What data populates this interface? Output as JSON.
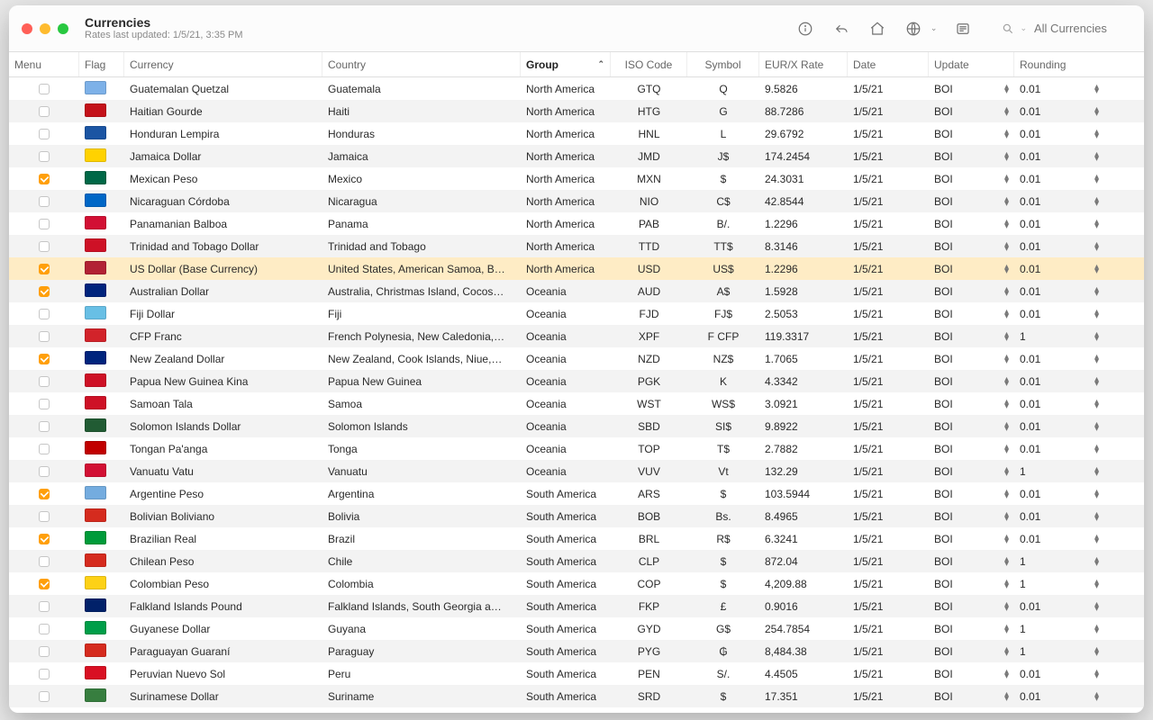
{
  "header": {
    "title": "Currencies",
    "subtitle": "Rates last updated: 1/5/21, 3:35 PM",
    "search_placeholder": "All Currencies"
  },
  "columns": {
    "menu": "Menu",
    "flag": "Flag",
    "currency": "Currency",
    "country": "Country",
    "group": "Group",
    "iso": "ISO Code",
    "symbol": "Symbol",
    "rate": "EUR/X Rate",
    "date": "Date",
    "update": "Update",
    "rounding": "Rounding"
  },
  "sort_column": "group",
  "rows": [
    {
      "checked": false,
      "flag": "#7db1e8",
      "currency": "Guatemalan Quetzal",
      "country": "Guatemala",
      "group": "North America",
      "iso": "GTQ",
      "symbol": "Q",
      "rate": "9.5826",
      "date": "1/5/21",
      "update": "BOI",
      "rounding": "0.01"
    },
    {
      "checked": false,
      "flag": "#c4121a",
      "currency": "Haitian Gourde",
      "country": "Haiti",
      "group": "North America",
      "iso": "HTG",
      "symbol": "G",
      "rate": "88.7286",
      "date": "1/5/21",
      "update": "BOI",
      "rounding": "0.01"
    },
    {
      "checked": false,
      "flag": "#1b55a3",
      "currency": "Honduran Lempira",
      "country": "Honduras",
      "group": "North America",
      "iso": "HNL",
      "symbol": "L",
      "rate": "29.6792",
      "date": "1/5/21",
      "update": "BOI",
      "rounding": "0.01"
    },
    {
      "checked": false,
      "flag": "#ffd200",
      "currency": "Jamaica Dollar",
      "country": "Jamaica",
      "group": "North America",
      "iso": "JMD",
      "symbol": "J$",
      "rate": "174.2454",
      "date": "1/5/21",
      "update": "BOI",
      "rounding": "0.01"
    },
    {
      "checked": true,
      "flag": "#006847",
      "currency": "Mexican Peso",
      "country": "Mexico",
      "group": "North America",
      "iso": "MXN",
      "symbol": "$",
      "rate": "24.3031",
      "date": "1/5/21",
      "update": "BOI",
      "rounding": "0.01"
    },
    {
      "checked": false,
      "flag": "#0067c6",
      "currency": "Nicaraguan Córdoba",
      "country": "Nicaragua",
      "group": "North America",
      "iso": "NIO",
      "symbol": "C$",
      "rate": "42.8544",
      "date": "1/5/21",
      "update": "BOI",
      "rounding": "0.01"
    },
    {
      "checked": false,
      "flag": "#d21034",
      "currency": "Panamanian Balboa",
      "country": "Panama",
      "group": "North America",
      "iso": "PAB",
      "symbol": "B/.",
      "rate": "1.2296",
      "date": "1/5/21",
      "update": "BOI",
      "rounding": "0.01"
    },
    {
      "checked": false,
      "flag": "#ce1126",
      "currency": "Trinidad and Tobago Dollar",
      "country": "Trinidad and Tobago",
      "group": "North America",
      "iso": "TTD",
      "symbol": "TT$",
      "rate": "8.3146",
      "date": "1/5/21",
      "update": "BOI",
      "rounding": "0.01"
    },
    {
      "checked": true,
      "flag": "#b22234",
      "selected": true,
      "currency": "US Dollar (Base Currency)",
      "country": "United States, American Samoa, B…",
      "group": "North America",
      "iso": "USD",
      "symbol": "US$",
      "rate": "1.2296",
      "date": "1/5/21",
      "update": "BOI",
      "rounding": "0.01"
    },
    {
      "checked": true,
      "flag": "#00247d",
      "currency": "Australian Dollar",
      "country": "Australia, Christmas Island, Cocos…",
      "group": "Oceania",
      "iso": "AUD",
      "symbol": "A$",
      "rate": "1.5928",
      "date": "1/5/21",
      "update": "BOI",
      "rounding": "0.01"
    },
    {
      "checked": false,
      "flag": "#68bfe5",
      "currency": "Fiji Dollar",
      "country": "Fiji",
      "group": "Oceania",
      "iso": "FJD",
      "symbol": "FJ$",
      "rate": "2.5053",
      "date": "1/5/21",
      "update": "BOI",
      "rounding": "0.01"
    },
    {
      "checked": false,
      "flag": "#d2232a",
      "currency": "CFP Franc",
      "country": "French Polynesia, New Caledonia,…",
      "group": "Oceania",
      "iso": "XPF",
      "symbol": "F CFP",
      "rate": "119.3317",
      "date": "1/5/21",
      "update": "BOI",
      "rounding": "1"
    },
    {
      "checked": true,
      "flag": "#00247d",
      "currency": "New Zealand Dollar",
      "country": "New Zealand, Cook Islands, Niue,…",
      "group": "Oceania",
      "iso": "NZD",
      "symbol": "NZ$",
      "rate": "1.7065",
      "date": "1/5/21",
      "update": "BOI",
      "rounding": "0.01"
    },
    {
      "checked": false,
      "flag": "#ce1126",
      "currency": "Papua New Guinea Kina",
      "country": "Papua New Guinea",
      "group": "Oceania",
      "iso": "PGK",
      "symbol": "K",
      "rate": "4.3342",
      "date": "1/5/21",
      "update": "BOI",
      "rounding": "0.01"
    },
    {
      "checked": false,
      "flag": "#ce1126",
      "currency": "Samoan Tala",
      "country": "Samoa",
      "group": "Oceania",
      "iso": "WST",
      "symbol": "WS$",
      "rate": "3.0921",
      "date": "1/5/21",
      "update": "BOI",
      "rounding": "0.01"
    },
    {
      "checked": false,
      "flag": "#215b33",
      "currency": "Solomon Islands Dollar",
      "country": "Solomon Islands",
      "group": "Oceania",
      "iso": "SBD",
      "symbol": "SI$",
      "rate": "9.8922",
      "date": "1/5/21",
      "update": "BOI",
      "rounding": "0.01"
    },
    {
      "checked": false,
      "flag": "#c10000",
      "currency": "Tongan Pa'anga",
      "country": "Tonga",
      "group": "Oceania",
      "iso": "TOP",
      "symbol": "T$",
      "rate": "2.7882",
      "date": "1/5/21",
      "update": "BOI",
      "rounding": "0.01"
    },
    {
      "checked": false,
      "flag": "#d21034",
      "currency": "Vanuatu Vatu",
      "country": "Vanuatu",
      "group": "Oceania",
      "iso": "VUV",
      "symbol": "Vt",
      "rate": "132.29",
      "date": "1/5/21",
      "update": "BOI",
      "rounding": "1"
    },
    {
      "checked": true,
      "flag": "#74acdf",
      "currency": "Argentine Peso",
      "country": "Argentina",
      "group": "South America",
      "iso": "ARS",
      "symbol": "$",
      "rate": "103.5944",
      "date": "1/5/21",
      "update": "BOI",
      "rounding": "0.01"
    },
    {
      "checked": false,
      "flag": "#d52b1e",
      "currency": "Bolivian Boliviano",
      "country": "Bolivia",
      "group": "South America",
      "iso": "BOB",
      "symbol": "Bs.",
      "rate": "8.4965",
      "date": "1/5/21",
      "update": "BOI",
      "rounding": "0.01"
    },
    {
      "checked": true,
      "flag": "#009b3a",
      "currency": "Brazilian Real",
      "country": "Brazil",
      "group": "South America",
      "iso": "BRL",
      "symbol": "R$",
      "rate": "6.3241",
      "date": "1/5/21",
      "update": "BOI",
      "rounding": "0.01"
    },
    {
      "checked": false,
      "flag": "#d52b1e",
      "currency": "Chilean Peso",
      "country": "Chile",
      "group": "South America",
      "iso": "CLP",
      "symbol": "$",
      "rate": "872.04",
      "date": "1/5/21",
      "update": "BOI",
      "rounding": "1"
    },
    {
      "checked": true,
      "flag": "#fdd116",
      "currency": "Colombian Peso",
      "country": "Colombia",
      "group": "South America",
      "iso": "COP",
      "symbol": "$",
      "rate": "4,209.88",
      "date": "1/5/21",
      "update": "BOI",
      "rounding": "1"
    },
    {
      "checked": false,
      "flag": "#012169",
      "currency": "Falkland Islands Pound",
      "country": "Falkland Islands, South Georgia a…",
      "group": "South America",
      "iso": "FKP",
      "symbol": "£",
      "rate": "0.9016",
      "date": "1/5/21",
      "update": "BOI",
      "rounding": "0.01"
    },
    {
      "checked": false,
      "flag": "#009e49",
      "currency": "Guyanese Dollar",
      "country": "Guyana",
      "group": "South America",
      "iso": "GYD",
      "symbol": "G$",
      "rate": "254.7854",
      "date": "1/5/21",
      "update": "BOI",
      "rounding": "1"
    },
    {
      "checked": false,
      "flag": "#d52b1e",
      "currency": "Paraguayan Guaraní",
      "country": "Paraguay",
      "group": "South America",
      "iso": "PYG",
      "symbol": "₲",
      "rate": "8,484.38",
      "date": "1/5/21",
      "update": "BOI",
      "rounding": "1"
    },
    {
      "checked": false,
      "flag": "#d91023",
      "currency": "Peruvian Nuevo Sol",
      "country": "Peru",
      "group": "South America",
      "iso": "PEN",
      "symbol": "S/.",
      "rate": "4.4505",
      "date": "1/5/21",
      "update": "BOI",
      "rounding": "0.01"
    },
    {
      "checked": false,
      "flag": "#377e3f",
      "currency": "Surinamese Dollar",
      "country": "Suriname",
      "group": "South America",
      "iso": "SRD",
      "symbol": "$",
      "rate": "17.351",
      "date": "1/5/21",
      "update": "BOI",
      "rounding": "0.01"
    }
  ]
}
